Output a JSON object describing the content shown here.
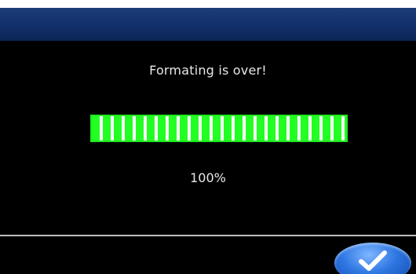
{
  "dialog": {
    "message": "Formating is over!",
    "progress": {
      "percent_label": "100%",
      "fraction": 1.0,
      "fill_color": "#22ff22",
      "stripe_color": "#ffffff"
    },
    "confirm_button": {
      "icon": "checkmark-icon"
    }
  },
  "colors": {
    "title_bar": "#12306a",
    "background": "#000000",
    "button": "#2f77e2"
  }
}
